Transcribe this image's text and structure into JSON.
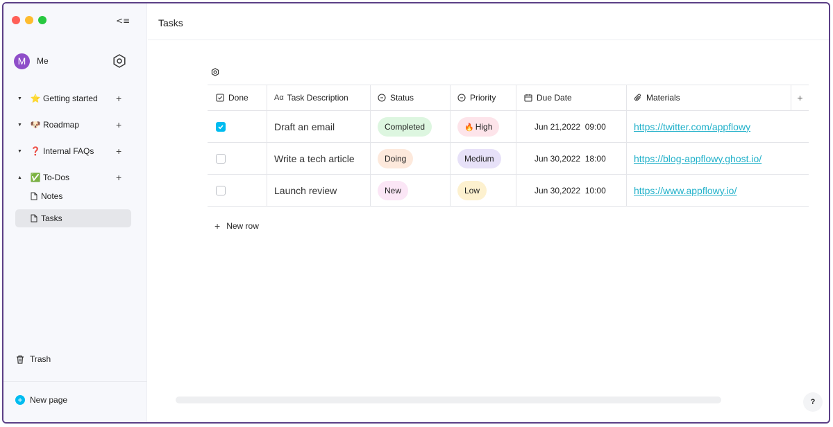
{
  "window": {
    "traffic_colors": {
      "close": "#ff5f57",
      "minimize": "#febc2e",
      "zoom": "#28c840"
    },
    "collapse_icon": "collapse-sidebar-icon",
    "collapse_glyph": "<≡"
  },
  "sidebar": {
    "user": {
      "avatar_letter": "M",
      "name": "Me",
      "avatar_color": "#8f4ec9"
    },
    "items": [
      {
        "emoji": "⭐",
        "label": "Getting started",
        "expanded": false
      },
      {
        "emoji": "🐶",
        "label": "Roadmap",
        "expanded": false
      },
      {
        "emoji": "❓",
        "label": "Internal FAQs",
        "expanded": false
      },
      {
        "emoji": "✅",
        "label": "To-Dos",
        "expanded": true,
        "children": [
          {
            "label": "Notes",
            "active": false
          },
          {
            "label": "Tasks",
            "active": true
          }
        ]
      }
    ],
    "trash_label": "Trash",
    "new_page_label": "New page"
  },
  "main": {
    "title": "Tasks",
    "columns": [
      {
        "label": "Done",
        "icon": "checkbox-icon"
      },
      {
        "label": "Task Description",
        "icon": "text-icon"
      },
      {
        "label": "Status",
        "icon": "select-icon"
      },
      {
        "label": "Priority",
        "icon": "select-icon"
      },
      {
        "label": "Due Date",
        "icon": "calendar-icon"
      },
      {
        "label": "Materials",
        "icon": "paperclip-icon"
      }
    ],
    "text_icon_glyph": "Aα",
    "rows": [
      {
        "done": true,
        "description": "Draft an email",
        "status": {
          "label": "Completed",
          "color": "#ddf6e0"
        },
        "priority": {
          "label": "High",
          "color": "#fde4ea",
          "emoji": "🔥"
        },
        "due": "Jun 21,2022  09:00",
        "link": "https://twitter.com/appflowy"
      },
      {
        "done": false,
        "description": "Write a tech article",
        "status": {
          "label": "Doing",
          "color": "#fde9dc"
        },
        "priority": {
          "label": "Medium",
          "color": "#e7e1f8"
        },
        "due": "Jun 30,2022  18:00",
        "link": "https://blog-appflowy.ghost.io/"
      },
      {
        "done": false,
        "description": "Launch review",
        "status": {
          "label": "New",
          "color": "#fbe6f6"
        },
        "priority": {
          "label": "Low",
          "color": "#fdf1cf"
        },
        "due": "Jun 30,2022  10:00",
        "link": "https://www.appflowy.io/"
      }
    ],
    "new_row_label": "New row",
    "add_column_symbol": "+",
    "help_label": "?"
  }
}
